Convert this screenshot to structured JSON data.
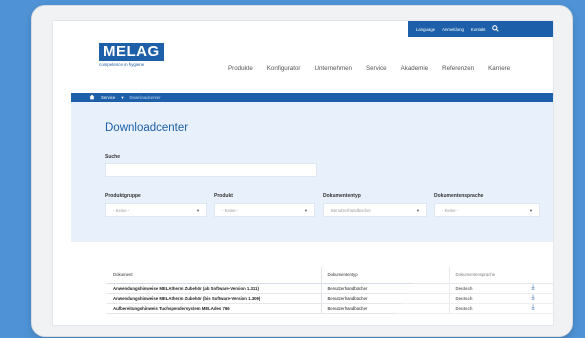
{
  "topbar": {
    "language": "Language",
    "anmeldung": "Anmeldung",
    "kontakt": "Kontakt",
    "search_icon": "search-icon"
  },
  "logo": {
    "name": "MELAG",
    "tagline": "competence in hygiene"
  },
  "nav": [
    "Produkte",
    "Konfigurator",
    "Unternehmen",
    "Service",
    "Akademie",
    "Referenzen",
    "Karriere"
  ],
  "breadcrumb": {
    "home_icon": "home-icon",
    "service": "Service",
    "current": "Downloadcenter"
  },
  "page": {
    "title": "Downloadcenter"
  },
  "search": {
    "label": "Suche",
    "value": ""
  },
  "filters": [
    {
      "label": "Produktgruppe",
      "value": "- Keine -"
    },
    {
      "label": "Produkt",
      "value": "- Keine -"
    },
    {
      "label": "Dokumententyp",
      "value": "Benutzerhandbücher"
    },
    {
      "label": "Dokumentensprache",
      "value": "- Keine -"
    }
  ],
  "table": {
    "headers": [
      "Dokument",
      "Dokumententyp",
      "Dokumentensprache"
    ],
    "rows": [
      {
        "doc": "Anwendungshinweise MELAtherm Zubehör (ab Software-Version 1.311)",
        "type": "Benutzerhandbücher",
        "lang": "Deutsch"
      },
      {
        "doc": "Anwendungshinweise MELAtherm Zubehör (bis Software-Version 1.309)",
        "type": "Benutzerhandbücher",
        "lang": "Deutsch"
      },
      {
        "doc": "Aufbereitungshinweis Tuchspendersystem MELAdes 766",
        "type": "Benutzerhandbücher",
        "lang": "Deutsch"
      }
    ]
  },
  "colors": {
    "brand": "#1d5fa8",
    "background": "#4f93d6",
    "hero": "#e8f1fb"
  }
}
